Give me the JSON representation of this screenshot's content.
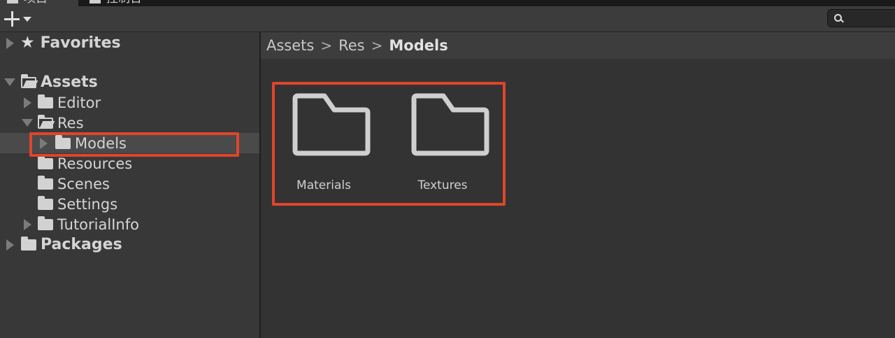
{
  "tabs": [
    {
      "label": "项目",
      "active": true
    },
    {
      "label": "控制台",
      "active": false
    }
  ],
  "toolbar": {
    "add_icon": "plus-icon",
    "dropdown_icon": "caret-down-icon",
    "search": {
      "placeholder": "",
      "icon": "search-icon"
    }
  },
  "tree": {
    "items": [
      {
        "label": "Favorites",
        "icon": "star-icon"
      },
      {
        "label": "Assets",
        "icon": "folder-open-icon"
      },
      {
        "label": "Editor",
        "icon": "folder-icon"
      },
      {
        "label": "Res",
        "icon": "folder-open-icon"
      },
      {
        "label": "Models",
        "icon": "folder-icon",
        "selected": true
      },
      {
        "label": "Resources",
        "icon": "folder-icon"
      },
      {
        "label": "Scenes",
        "icon": "folder-icon"
      },
      {
        "label": "Settings",
        "icon": "folder-icon"
      },
      {
        "label": "TutorialInfo",
        "icon": "folder-icon"
      },
      {
        "label": "Packages",
        "icon": "folder-icon"
      }
    ]
  },
  "breadcrumb": {
    "parts": [
      "Assets",
      "Res",
      "Models"
    ],
    "separator": ">"
  },
  "content": {
    "items": [
      {
        "label": "Materials",
        "icon": "folder-icon"
      },
      {
        "label": "Textures",
        "icon": "folder-icon"
      }
    ]
  },
  "colors": {
    "highlight": "#e0452a",
    "background": "#383838",
    "panel": "#333333"
  }
}
